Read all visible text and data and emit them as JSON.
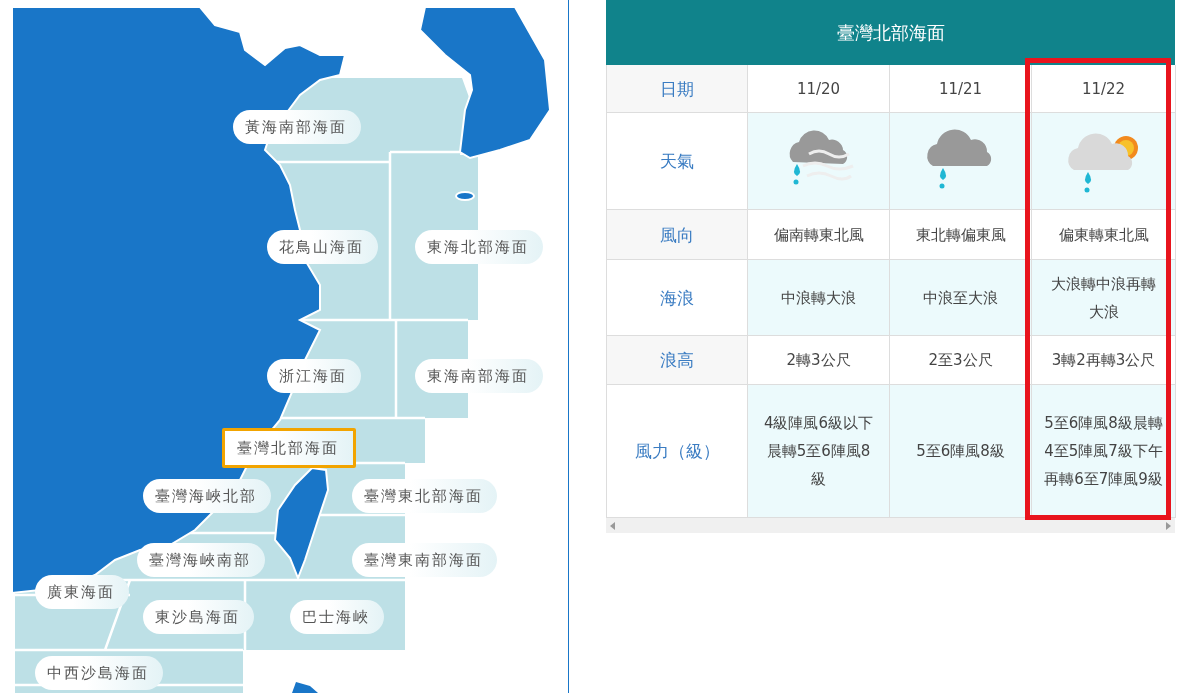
{
  "map": {
    "regions": [
      {
        "label": "黃海南部海面",
        "selected": false
      },
      {
        "label": "花鳥山海面",
        "selected": false
      },
      {
        "label": "東海北部海面",
        "selected": false
      },
      {
        "label": "浙江海面",
        "selected": false
      },
      {
        "label": "東海南部海面",
        "selected": false
      },
      {
        "label": "臺灣北部海面",
        "selected": true
      },
      {
        "label": "臺灣海峽北部",
        "selected": false
      },
      {
        "label": "臺灣東北部海面",
        "selected": false
      },
      {
        "label": "臺灣海峽南部",
        "selected": false
      },
      {
        "label": "臺灣東南部海面",
        "selected": false
      },
      {
        "label": "廣東海面",
        "selected": false
      },
      {
        "label": "東沙島海面",
        "selected": false
      },
      {
        "label": "巴士海峽",
        "selected": false
      },
      {
        "label": "中西沙島海面",
        "selected": false
      }
    ]
  },
  "forecast": {
    "title": "臺灣北部海面",
    "row_headers": [
      "日期",
      "天氣",
      "風向",
      "海浪",
      "浪高",
      "風力（級）"
    ],
    "days": [
      {
        "date": "11/20",
        "weather": {
          "kind": "rain-wind"
        },
        "wind_direction": "偏南轉東北風",
        "waves": "中浪轉大浪",
        "wave_height": "2轉3公尺",
        "wind_force": "4級陣風6級以下晨轉5至6陣風8級",
        "highlighted": false
      },
      {
        "date": "11/21",
        "weather": {
          "kind": "rain"
        },
        "wind_direction": "東北轉偏東風",
        "waves": "中浪至大浪",
        "wave_height": "2至3公尺",
        "wind_force": "5至6陣風8級",
        "highlighted": false
      },
      {
        "date": "11/22",
        "weather": {
          "kind": "partly-cloudy-rain"
        },
        "wind_direction": "偏東轉東北風",
        "waves": "大浪轉中浪再轉大浪",
        "wave_height": "3轉2再轉3公尺",
        "wind_force": "5至6陣風8級晨轉4至5陣風7級下午再轉6至7陣風9級",
        "highlighted": true
      }
    ]
  }
}
